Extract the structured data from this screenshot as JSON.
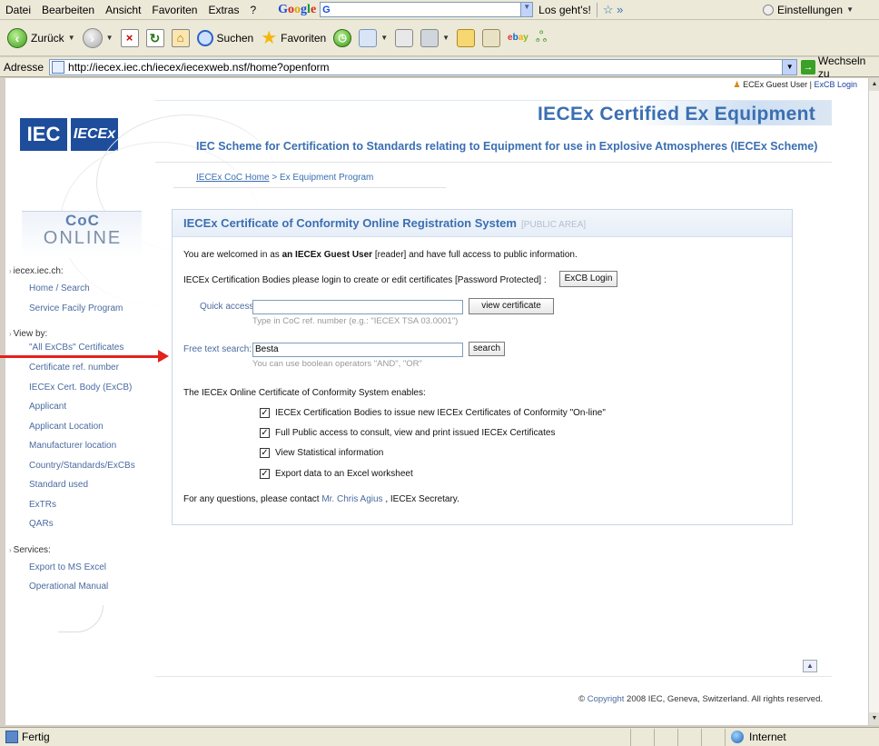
{
  "browser": {
    "menu": [
      "Datei",
      "Bearbeiten",
      "Ansicht",
      "Favoriten",
      "Extras",
      "?"
    ],
    "google_text": "G",
    "los_gehts": "Los geht's!",
    "settings": "Einstellungen",
    "back": "Zurück",
    "search": "Suchen",
    "favorites": "Favoriten",
    "address_label": "Adresse",
    "url": "http://iecex.iec.ch/iecex/iecexweb.nsf/home?openform",
    "go": "Wechseln zu",
    "status": "Fertig",
    "zone": "Internet"
  },
  "header": {
    "guest": "ECEx Guest User",
    "exc_login": "ExCB Login",
    "iec_logo": "IEC",
    "iecex_logo": "IECEx",
    "title": "IECEx Certified Ex Equipment",
    "subtitle": "IEC Scheme for Certification to Standards relating to Equipment for use in Explosive Atmospheres (IECEx Scheme)",
    "crumb_home": "IECEx CoC Home",
    "crumb_current": "> Ex Equipment Program"
  },
  "sidebar": {
    "coc": "CoC",
    "online": "ONLINE",
    "site_label": "iecex.iec.ch:",
    "site_items": [
      "Home / Search",
      "Service Facily Program"
    ],
    "view_label": "View by:",
    "view_items": [
      "\"All ExCBs\" Certificates",
      "Certificate ref. number",
      "IECEx Cert. Body (ExCB)",
      "Applicant",
      "Applicant Location",
      "Manufacturer location",
      "Country/Standards/ExCBs",
      "Standard used",
      "ExTRs",
      "QARs"
    ],
    "services_label": "Services:",
    "services_items": [
      "Export to MS Excel",
      "Operational Manual"
    ]
  },
  "main": {
    "title": "IECEx Certificate of Conformity Online Registration System",
    "public_area": "[PUBLIC AREA]",
    "welcome_pre": "You are welcomed in as",
    "welcome_bold": "an IECEx Guest User",
    "welcome_post": "[reader] and have full access to public information.",
    "login_text": "IECEx Certification Bodies please login to create or edit certificates [Password Protected] :",
    "login_button": "ExCB Login",
    "quick_label": "Quick access:",
    "quick_value": "",
    "view_cert_button": "view certificate",
    "quick_hint": "Type in CoC ref. number (e.g.: \"IECEX TSA 03.0001\")",
    "free_label": "Free text search:",
    "free_value": "Besta",
    "search_button": "search",
    "free_hint": "You can use boolean operators \"AND\", \"OR\"",
    "enables": "The IECEx Online Certificate of Conformity System enables:",
    "features": [
      "IECEx Certification Bodies to issue new IECEx Certificates of Conformity \"On-line\"",
      "Full Public access to consult, view and print issued IECEx Certificates",
      "View Statistical information",
      "Export data to an Excel worksheet"
    ],
    "contact_pre": "For any questions, please contact",
    "contact_name": "Mr. Chris Agius",
    "contact_post": ", IECEx Secretary."
  },
  "footer": {
    "copyright_pre": "©",
    "copyright_link": "Copyright",
    "copyright_post": "2008 IEC, Geneva, Switzerland. All rights reserved."
  }
}
